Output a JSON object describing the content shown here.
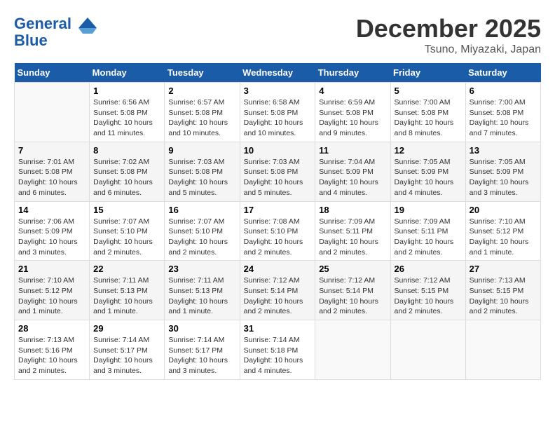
{
  "header": {
    "logo_line1": "General",
    "logo_line2": "Blue",
    "month": "December 2025",
    "location": "Tsuno, Miyazaki, Japan"
  },
  "weekdays": [
    "Sunday",
    "Monday",
    "Tuesday",
    "Wednesday",
    "Thursday",
    "Friday",
    "Saturday"
  ],
  "weeks": [
    [
      {
        "day": "",
        "info": ""
      },
      {
        "day": "1",
        "info": "Sunrise: 6:56 AM\nSunset: 5:08 PM\nDaylight: 10 hours\nand 11 minutes."
      },
      {
        "day": "2",
        "info": "Sunrise: 6:57 AM\nSunset: 5:08 PM\nDaylight: 10 hours\nand 10 minutes."
      },
      {
        "day": "3",
        "info": "Sunrise: 6:58 AM\nSunset: 5:08 PM\nDaylight: 10 hours\nand 10 minutes."
      },
      {
        "day": "4",
        "info": "Sunrise: 6:59 AM\nSunset: 5:08 PM\nDaylight: 10 hours\nand 9 minutes."
      },
      {
        "day": "5",
        "info": "Sunrise: 7:00 AM\nSunset: 5:08 PM\nDaylight: 10 hours\nand 8 minutes."
      },
      {
        "day": "6",
        "info": "Sunrise: 7:00 AM\nSunset: 5:08 PM\nDaylight: 10 hours\nand 7 minutes."
      }
    ],
    [
      {
        "day": "7",
        "info": "Sunrise: 7:01 AM\nSunset: 5:08 PM\nDaylight: 10 hours\nand 6 minutes."
      },
      {
        "day": "8",
        "info": "Sunrise: 7:02 AM\nSunset: 5:08 PM\nDaylight: 10 hours\nand 6 minutes."
      },
      {
        "day": "9",
        "info": "Sunrise: 7:03 AM\nSunset: 5:08 PM\nDaylight: 10 hours\nand 5 minutes."
      },
      {
        "day": "10",
        "info": "Sunrise: 7:03 AM\nSunset: 5:08 PM\nDaylight: 10 hours\nand 5 minutes."
      },
      {
        "day": "11",
        "info": "Sunrise: 7:04 AM\nSunset: 5:09 PM\nDaylight: 10 hours\nand 4 minutes."
      },
      {
        "day": "12",
        "info": "Sunrise: 7:05 AM\nSunset: 5:09 PM\nDaylight: 10 hours\nand 4 minutes."
      },
      {
        "day": "13",
        "info": "Sunrise: 7:05 AM\nSunset: 5:09 PM\nDaylight: 10 hours\nand 3 minutes."
      }
    ],
    [
      {
        "day": "14",
        "info": "Sunrise: 7:06 AM\nSunset: 5:09 PM\nDaylight: 10 hours\nand 3 minutes."
      },
      {
        "day": "15",
        "info": "Sunrise: 7:07 AM\nSunset: 5:10 PM\nDaylight: 10 hours\nand 2 minutes."
      },
      {
        "day": "16",
        "info": "Sunrise: 7:07 AM\nSunset: 5:10 PM\nDaylight: 10 hours\nand 2 minutes."
      },
      {
        "day": "17",
        "info": "Sunrise: 7:08 AM\nSunset: 5:10 PM\nDaylight: 10 hours\nand 2 minutes."
      },
      {
        "day": "18",
        "info": "Sunrise: 7:09 AM\nSunset: 5:11 PM\nDaylight: 10 hours\nand 2 minutes."
      },
      {
        "day": "19",
        "info": "Sunrise: 7:09 AM\nSunset: 5:11 PM\nDaylight: 10 hours\nand 2 minutes."
      },
      {
        "day": "20",
        "info": "Sunrise: 7:10 AM\nSunset: 5:12 PM\nDaylight: 10 hours\nand 1 minute."
      }
    ],
    [
      {
        "day": "21",
        "info": "Sunrise: 7:10 AM\nSunset: 5:12 PM\nDaylight: 10 hours\nand 1 minute."
      },
      {
        "day": "22",
        "info": "Sunrise: 7:11 AM\nSunset: 5:13 PM\nDaylight: 10 hours\nand 1 minute."
      },
      {
        "day": "23",
        "info": "Sunrise: 7:11 AM\nSunset: 5:13 PM\nDaylight: 10 hours\nand 1 minute."
      },
      {
        "day": "24",
        "info": "Sunrise: 7:12 AM\nSunset: 5:14 PM\nDaylight: 10 hours\nand 2 minutes."
      },
      {
        "day": "25",
        "info": "Sunrise: 7:12 AM\nSunset: 5:14 PM\nDaylight: 10 hours\nand 2 minutes."
      },
      {
        "day": "26",
        "info": "Sunrise: 7:12 AM\nSunset: 5:15 PM\nDaylight: 10 hours\nand 2 minutes."
      },
      {
        "day": "27",
        "info": "Sunrise: 7:13 AM\nSunset: 5:15 PM\nDaylight: 10 hours\nand 2 minutes."
      }
    ],
    [
      {
        "day": "28",
        "info": "Sunrise: 7:13 AM\nSunset: 5:16 PM\nDaylight: 10 hours\nand 2 minutes."
      },
      {
        "day": "29",
        "info": "Sunrise: 7:14 AM\nSunset: 5:17 PM\nDaylight: 10 hours\nand 3 minutes."
      },
      {
        "day": "30",
        "info": "Sunrise: 7:14 AM\nSunset: 5:17 PM\nDaylight: 10 hours\nand 3 minutes."
      },
      {
        "day": "31",
        "info": "Sunrise: 7:14 AM\nSunset: 5:18 PM\nDaylight: 10 hours\nand 4 minutes."
      },
      {
        "day": "",
        "info": ""
      },
      {
        "day": "",
        "info": ""
      },
      {
        "day": "",
        "info": ""
      }
    ]
  ]
}
